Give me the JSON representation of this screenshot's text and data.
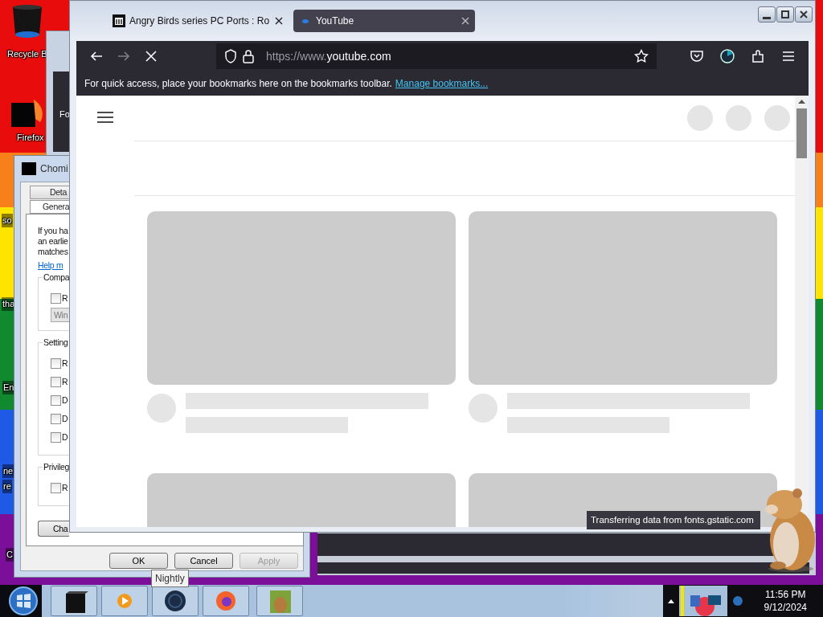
{
  "desktop": {
    "icons": [
      {
        "label": "Recycle B",
        "kind": "bin"
      },
      {
        "label": "Firefox",
        "kind": "firefox"
      }
    ],
    "label_fragments": [
      "so",
      "tha",
      "En",
      "ne",
      "re",
      "C"
    ]
  },
  "back_window": {
    "text": "Fo"
  },
  "dialog": {
    "title": "Chomi",
    "tabs": [
      {
        "label": "Deta",
        "selected": false
      },
      {
        "label": "Genera",
        "selected": true
      }
    ],
    "intro_lines": [
      "If you ha",
      "an earlie",
      "matches"
    ],
    "help_link": "Help m",
    "groups": [
      {
        "title": "Compa",
        "options": [
          {
            "label": "R",
            "checked": false
          }
        ],
        "dropdown": "Win"
      },
      {
        "title": "Setting",
        "options": [
          {
            "label": "R",
            "checked": false
          },
          {
            "label": "R",
            "checked": false
          },
          {
            "label": "D",
            "checked": false
          },
          {
            "label": "D",
            "checked": false
          },
          {
            "label": "D",
            "checked": false
          }
        ]
      },
      {
        "title": "Privileg",
        "options": [
          {
            "label": "R",
            "checked": false
          }
        ]
      }
    ],
    "change_button": "Cha",
    "buttons": [
      {
        "label": "OK",
        "disabled": false
      },
      {
        "label": "Cancel",
        "disabled": false
      },
      {
        "label": "Apply",
        "disabled": true
      }
    ]
  },
  "browser": {
    "tabs": [
      {
        "title": "Angry Birds series PC Ports : Ro",
        "selected": false
      },
      {
        "title": "YouTube",
        "selected": true
      }
    ],
    "forward_disabled": true,
    "url": {
      "prefix": "https://www.",
      "host": "youtube.com"
    },
    "bookmarks_hint": "For quick access, place your bookmarks here on the bookmarks toolbar.",
    "bookmarks_link": "Manage bookmarks...",
    "status": "Transferring data from fonts.gstatic.com"
  },
  "tooltip": "Nightly",
  "clock": {
    "time": "11:56 PM",
    "date": "9/12/2024"
  }
}
